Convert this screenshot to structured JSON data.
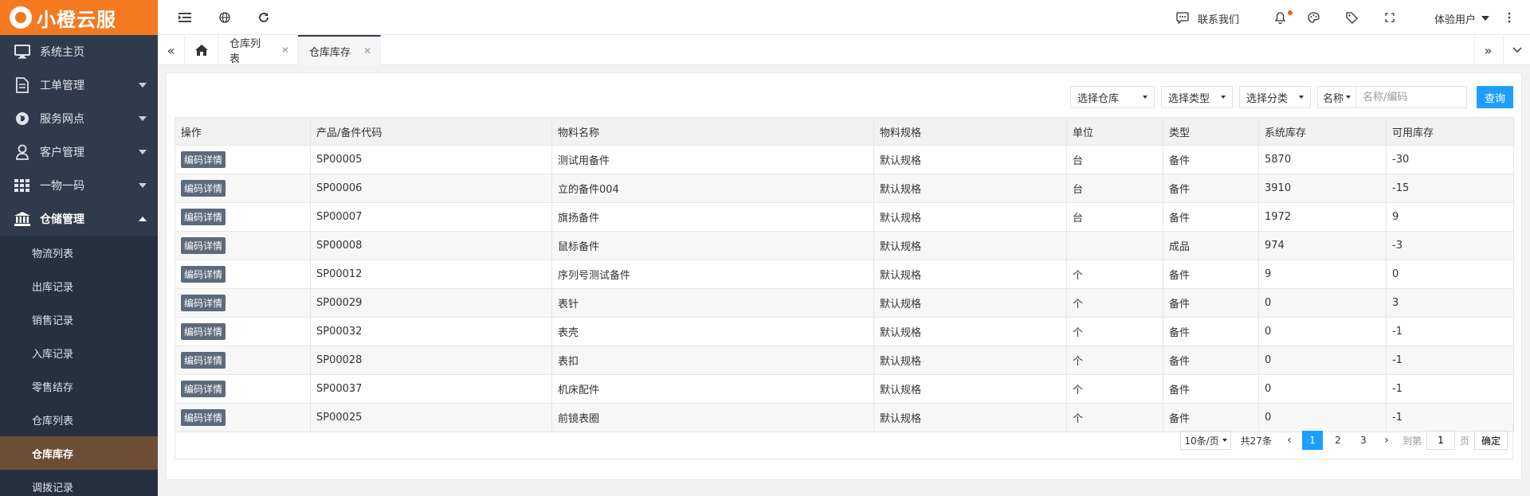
{
  "app": {
    "logo_text": "小橙云服"
  },
  "sidebar": {
    "items": [
      {
        "label": "系统主页",
        "icon": "monitor-icon"
      },
      {
        "label": "工单管理",
        "icon": "document-icon",
        "has_caret": true
      },
      {
        "label": "服务网点",
        "icon": "globe-icon",
        "has_caret": true
      },
      {
        "label": "客户管理",
        "icon": "user-icon",
        "has_caret": true
      },
      {
        "label": "一物一码",
        "icon": "grid-icon",
        "has_caret": true
      },
      {
        "label": "仓储管理",
        "icon": "bank-icon",
        "expanded": true
      }
    ],
    "sub_items": [
      {
        "label": "物流列表"
      },
      {
        "label": "出库记录"
      },
      {
        "label": "销售记录"
      },
      {
        "label": "入库记录"
      },
      {
        "label": "零售结存"
      },
      {
        "label": "仓库列表"
      },
      {
        "label": "仓库库存",
        "active": true
      },
      {
        "label": "调拨记录"
      }
    ]
  },
  "topbar": {
    "contact_label": "联系我们",
    "user_label": "体验用户",
    "notification_dot_color": "#ff5722"
  },
  "tabs": [
    {
      "label": "仓库列表"
    },
    {
      "label": "仓库库存",
      "active": true
    }
  ],
  "filters": {
    "warehouse_select": "选择仓库",
    "type_select": "选择类型",
    "category_select": "选择分类",
    "field_select": "名称",
    "search_placeholder": "名称/编码",
    "query_button": "查询"
  },
  "table": {
    "headers": [
      "操作",
      "产品/备件代码",
      "物料名称",
      "物料规格",
      "单位",
      "类型",
      "系统库存",
      "可用库存"
    ],
    "action_label": "编码详情",
    "rows": [
      {
        "code": "SP00005",
        "name": "测试用备件",
        "spec": "默认规格",
        "unit": "台",
        "type": "备件",
        "system_stock": "5870",
        "available_stock": "-30"
      },
      {
        "code": "SP00006",
        "name": "立的备件004",
        "spec": "默认规格",
        "unit": "台",
        "type": "备件",
        "system_stock": "3910",
        "available_stock": "-15"
      },
      {
        "code": "SP00007",
        "name": "旗扬备件",
        "spec": "默认规格",
        "unit": "台",
        "type": "备件",
        "system_stock": "1972",
        "available_stock": "9"
      },
      {
        "code": "SP00008",
        "name": "鼠标备件",
        "spec": "默认规格",
        "unit": "",
        "type": "成品",
        "system_stock": "974",
        "available_stock": "-3"
      },
      {
        "code": "SP00012",
        "name": "序列号测试备件",
        "spec": "默认规格",
        "unit": "个",
        "type": "备件",
        "system_stock": "9",
        "available_stock": "0"
      },
      {
        "code": "SP00029",
        "name": "表针",
        "spec": "默认规格",
        "unit": "个",
        "type": "备件",
        "system_stock": "0",
        "available_stock": "3"
      },
      {
        "code": "SP00032",
        "name": "表壳",
        "spec": "默认规格",
        "unit": "个",
        "type": "备件",
        "system_stock": "0",
        "available_stock": "-1"
      },
      {
        "code": "SP00028",
        "name": "表扣",
        "spec": "默认规格",
        "unit": "个",
        "type": "备件",
        "system_stock": "0",
        "available_stock": "-1"
      },
      {
        "code": "SP00037",
        "name": "机床配件",
        "spec": "默认规格",
        "unit": "个",
        "type": "备件",
        "system_stock": "0",
        "available_stock": "-1"
      },
      {
        "code": "SP00025",
        "name": "前镜表圈",
        "spec": "默认规格",
        "unit": "个",
        "type": "备件",
        "system_stock": "0",
        "available_stock": "-1"
      }
    ]
  },
  "pagination": {
    "page_size": "10条/页",
    "total": "共27条",
    "pages": [
      "1",
      "2",
      "3"
    ],
    "current_page": "1",
    "goto_label": "到第",
    "goto_value": "1",
    "page_suffix": "页",
    "confirm_label": "确定"
  },
  "colors": {
    "sidebar_bg": "#2f3b4c",
    "logo_bg": "#f47920",
    "active_sub_bg": "#6e4d36",
    "primary_button": "#1e9fff"
  }
}
